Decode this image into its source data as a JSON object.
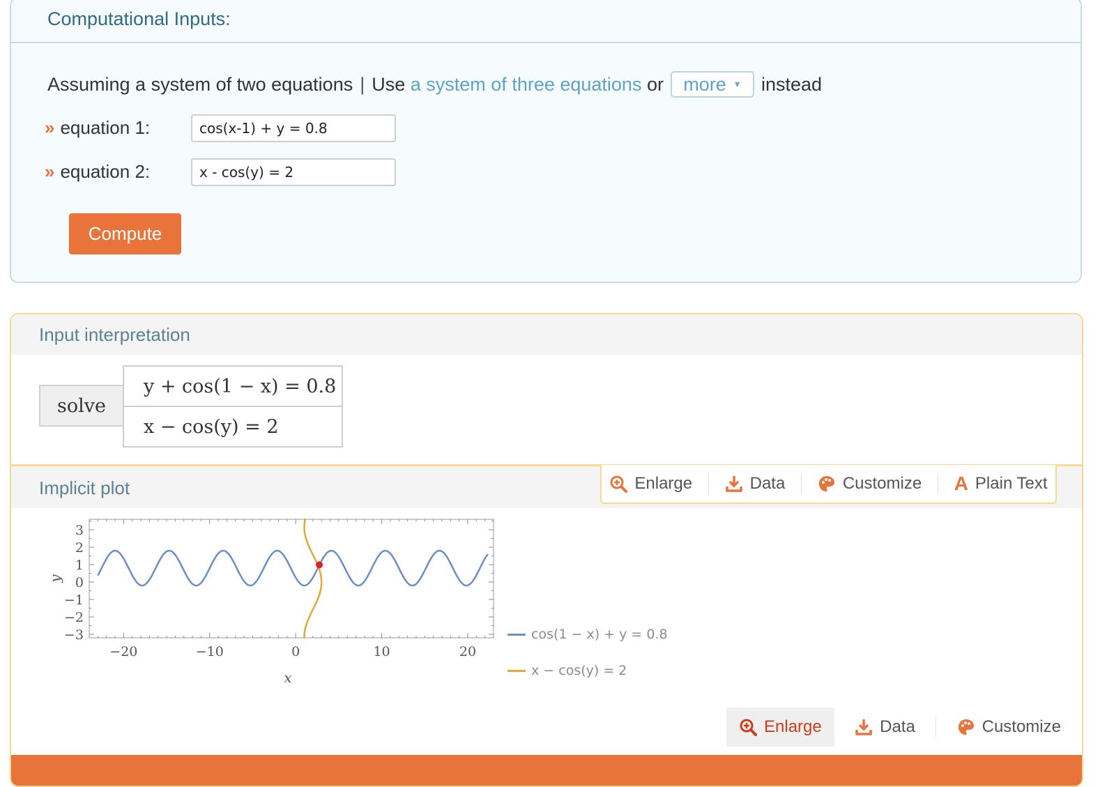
{
  "inputs": {
    "title": "Computational Inputs:",
    "assuming_prefix": "Assuming a system of two equations",
    "separator": "|",
    "use_text": "Use",
    "alt_link": "a system of three equations",
    "or_text": "or",
    "more_label": "more",
    "instead_text": "instead",
    "equation1_label": "equation 1:",
    "equation1_value": "cos(x-1) + y = 0.8",
    "equation2_label": "equation 2:",
    "equation2_value": "x - cos(y) = 2",
    "chevron": "»",
    "compute_label": "Compute"
  },
  "interpretation": {
    "title": "Input interpretation",
    "solve_label": "solve",
    "eq1": "y + cos(1 − x) = 0.8",
    "eq2": "x − cos(y) = 2"
  },
  "plot_pod": {
    "title": "Implicit plot",
    "toolbar": {
      "enlarge": "Enlarge",
      "data": "Data",
      "customize": "Customize",
      "plain_text": "Plain Text"
    },
    "bottom_toolbar": {
      "enlarge": "Enlarge",
      "data": "Data",
      "customize": "Customize"
    }
  },
  "colors": {
    "accent_orange": "#e8743b",
    "link_blue": "#5ea3c7",
    "curve_blue": "#6b8ec4",
    "curve_orange": "#e0a838",
    "intersection_red": "#e0202a"
  },
  "chart_data": {
    "type": "line",
    "xlabel": "x",
    "ylabel": "y",
    "xlim": [
      -24,
      23
    ],
    "ylim": [
      -3.2,
      3.6
    ],
    "x_ticks": [
      -20,
      -10,
      0,
      10,
      20
    ],
    "y_ticks": [
      3,
      2,
      1,
      0,
      -1,
      -2,
      -3
    ],
    "grid": false,
    "legend_position": "right-bottom",
    "series": [
      {
        "name": "cos(1 − x) + y = 0.8",
        "equation": "y = 0.8 − cos(1 − x)",
        "color": "#6b8ec4"
      },
      {
        "name": "x − cos(y) = 2",
        "equation": "x = 2 + cos(y)",
        "color": "#e0a838"
      }
    ],
    "intersection": {
      "x": 2.75,
      "y": 0.99
    }
  }
}
